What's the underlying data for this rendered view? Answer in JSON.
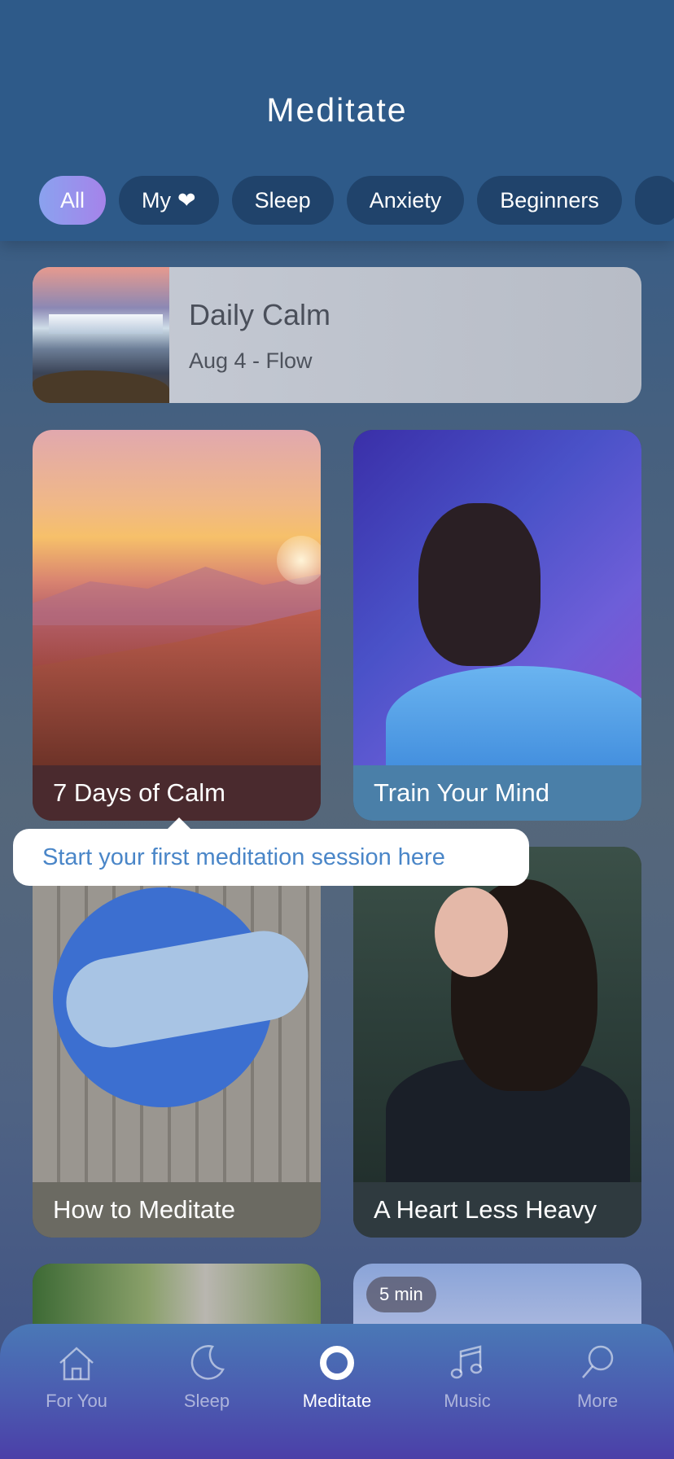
{
  "header": {
    "title": "Meditate"
  },
  "filters": [
    {
      "label": "All",
      "active": true
    },
    {
      "label": "My",
      "icon": "heart-icon"
    },
    {
      "label": "Sleep"
    },
    {
      "label": "Anxiety"
    },
    {
      "label": "Beginners"
    }
  ],
  "daily_calm": {
    "title": "Daily Calm",
    "subtitle": "Aug 4 - Flow"
  },
  "cards": [
    {
      "title": "7 Days of Calm"
    },
    {
      "title": "Train Your Mind"
    },
    {
      "title": "How to Meditate"
    },
    {
      "title": "A Heart Less Heavy"
    },
    {
      "title": ""
    },
    {
      "title": "",
      "badge": "5 min"
    }
  ],
  "tooltip": {
    "text": "Start your first meditation session here"
  },
  "tabbar": {
    "items": [
      {
        "label": "For You",
        "icon": "home-icon"
      },
      {
        "label": "Sleep",
        "icon": "moon-icon"
      },
      {
        "label": "Meditate",
        "icon": "ring-icon",
        "active": true
      },
      {
        "label": "Music",
        "icon": "music-note-icon"
      },
      {
        "label": "More",
        "icon": "search-icon"
      }
    ]
  },
  "colors": {
    "accent": "#4a86c8",
    "header": "#2e5a89",
    "chip_active_start": "#8aa2ef",
    "chip_active_end": "#a583ea"
  }
}
